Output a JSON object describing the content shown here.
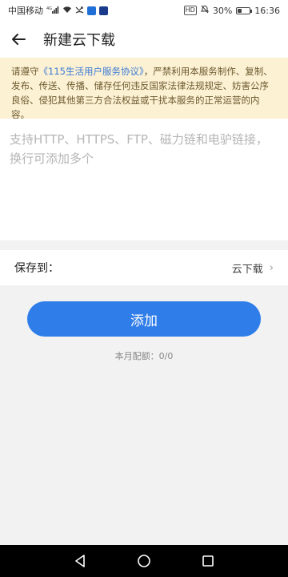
{
  "status_bar": {
    "carrier": "中国移动",
    "signal_label": "4G",
    "hd_label": "HD",
    "battery_text": "30%",
    "battery_level": 0.3,
    "time": "16:36"
  },
  "header": {
    "back_icon": "arrow-left-icon",
    "title": "新建云下载"
  },
  "notice": {
    "prefix": "请遵守",
    "agreement_link": "《115生活用户服务协议》",
    "suffix": "，严禁利用本服务制作、复制、发布、传送、传播、储存任何违反国家法律法规规定、妨害公序良俗、侵犯其他第三方合法权益或干扰本服务的正常运营的内容。"
  },
  "url_input": {
    "placeholder": "支持HTTP、HTTPS、FTP、磁力链和电驴链接，换行可添加多个",
    "value": ""
  },
  "save_to": {
    "label": "保存到：",
    "value": "云下载",
    "chevron": "›"
  },
  "add_button": {
    "label": "添加"
  },
  "quota": {
    "text": "本月配额：0/0"
  },
  "colors": {
    "accent": "#2f7de8",
    "notice_bg": "#fdf1d4",
    "link": "#3a7bd5"
  }
}
